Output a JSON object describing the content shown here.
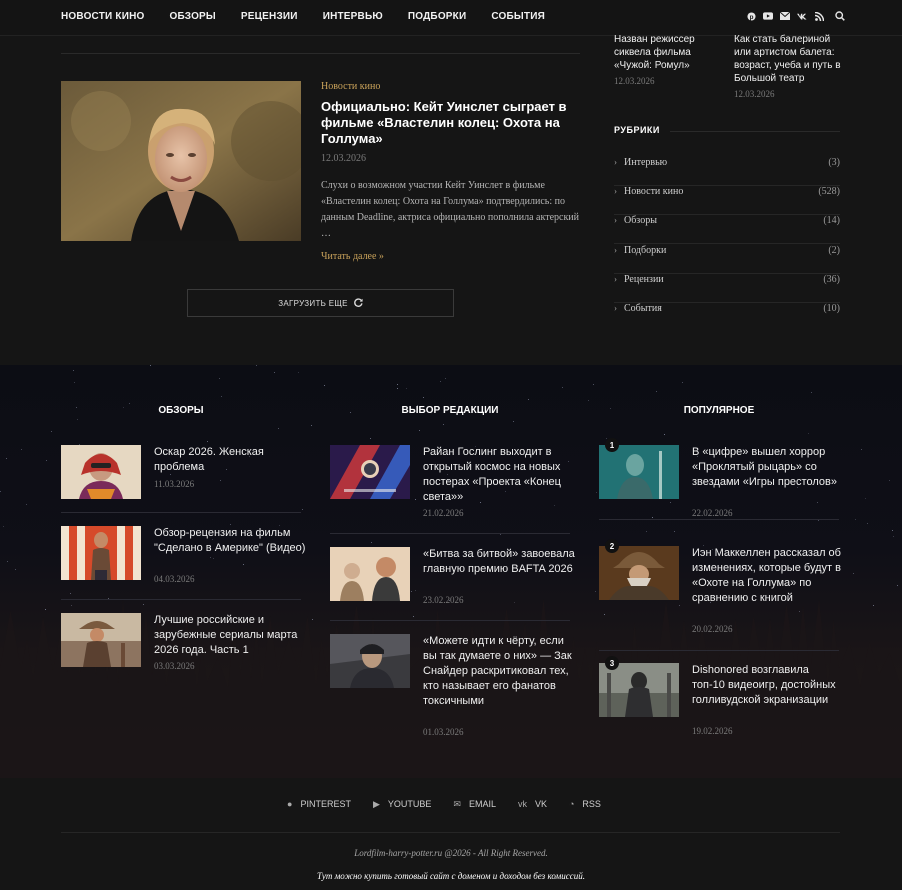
{
  "nav": {
    "items": [
      "НОВОСТИ КИНО",
      "ОБЗОРЫ",
      "РЕЦЕНЗИИ",
      "ИНТЕРВЬЮ",
      "ПОДБОРКИ",
      "СОБЫТИЯ"
    ],
    "icons": [
      "pinterest-icon",
      "youtube-icon",
      "email-icon",
      "vk-icon",
      "rss-icon",
      "search-icon"
    ]
  },
  "post": {
    "category": "Новости кино",
    "title": "Официально: Кейт Уинслет сыграет в фильме «Властелин колец: Охота на Голлума»",
    "date": "12.03.2026",
    "excerpt": "Слухи о возможном участии Кейт Уинслет в фильме «Властелин колец: Охота на Голлума» подтвердились: по данным Deadline, актриса официально пополнила актерский …",
    "read_more": "Читать далее »"
  },
  "load_more": "ЗАГРУЗИТЬ ЕЩЕ",
  "sidebar": {
    "posts": [
      {
        "title": "Назван режиссер сиквела фильма «Чужой: Ромул»",
        "date": "12.03.2026"
      },
      {
        "title": "Как стать балериной или артистом балета: возраст, учеба и путь в Большой театр",
        "date": "12.03.2026"
      }
    ],
    "rubrics_title": "РУБРИКИ",
    "rubrics": [
      {
        "name": "Интервью",
        "count": "(3)"
      },
      {
        "name": "Новости кино",
        "count": "(528)"
      },
      {
        "name": "Обзоры",
        "count": "(14)"
      },
      {
        "name": "Подборки",
        "count": "(2)"
      },
      {
        "name": "Рецензии",
        "count": "(36)"
      },
      {
        "name": "События",
        "count": "(10)"
      }
    ]
  },
  "widgets": {
    "reviews": {
      "title": "ОБЗОРЫ",
      "items": [
        {
          "title": "Оскар 2026. Женская проблема",
          "date": "11.03.2026"
        },
        {
          "title": "Обзор-рецензия на фильм \"Сделано в Америке\" (Видео)",
          "date": "04.03.2026"
        },
        {
          "title": "Лучшие российские и зарубежные сериалы марта 2026 года. Часть 1",
          "date": "03.03.2026"
        }
      ]
    },
    "editors": {
      "title": "ВЫБОР РЕДАКЦИИ",
      "items": [
        {
          "title": "Райан Гослинг выходит в открытый космос на новых постерах «Проекта «Конец света»»",
          "date": "21.02.2026"
        },
        {
          "title": "«Битва за битвой» завоевала главную премию BAFTA 2026",
          "date": "23.02.2026"
        },
        {
          "title": "«Можете идти к чёрту, если вы так думаете о них» — Зак Снайдер раскритиковал тех, кто называет его фанатов токсичными",
          "date": "01.03.2026"
        }
      ]
    },
    "popular": {
      "title": "ПОПУЛЯРНОЕ",
      "items": [
        {
          "rank": "1",
          "title": "В «цифре» вышел хоррор «Проклятый рыцарь» со звездами «Игры престолов»",
          "date": "22.02.2026"
        },
        {
          "rank": "2",
          "title": "Иэн Маккеллен рассказал об изменениях, которые будут в «Охоте на Голлума» по сравнению с книгой",
          "date": "20.02.2026"
        },
        {
          "rank": "3",
          "title": "Dishonored возглавила топ-10 видеоигр, достойных голливудской экранизации",
          "date": "19.02.2026"
        }
      ]
    }
  },
  "footer": {
    "social": [
      {
        "icon": "pinterest-icon",
        "label": "PINTEREST"
      },
      {
        "icon": "youtube-icon",
        "label": "YOUTUBE"
      },
      {
        "icon": "email-icon",
        "label": "EMAIL"
      },
      {
        "icon": "vk-icon",
        "label": "VK"
      },
      {
        "icon": "rss-icon",
        "label": "RSS"
      }
    ],
    "copyright": "Lordfilm-harry-potter.ru @2026 - All Right Reserved.",
    "promo": "Тут можно купить готовый сайт с доменом и доходом без комиссий."
  },
  "colors": {
    "accent": "#c9a25a",
    "background": "#151515"
  }
}
